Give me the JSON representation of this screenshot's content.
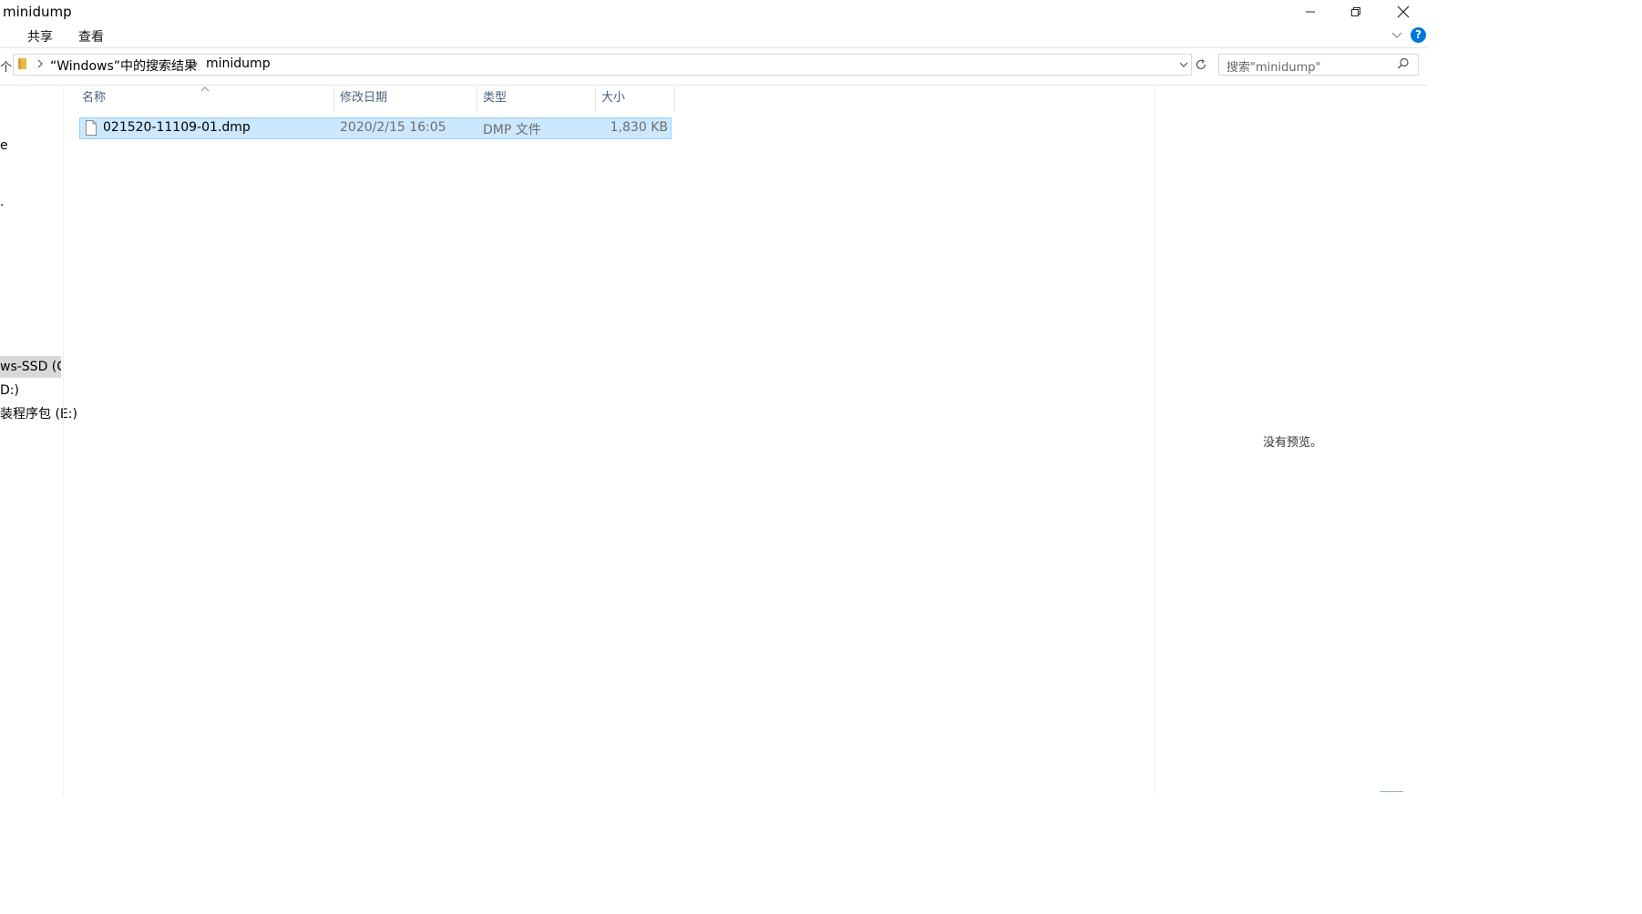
{
  "window": {
    "title": "minidump"
  },
  "ribbon": {
    "tabs": [
      "共享",
      "查看"
    ]
  },
  "address": {
    "crumbs": [
      "“Windows”中的搜索结果",
      "minidump"
    ],
    "search_placeholder": "搜索\"minidump\""
  },
  "nav": {
    "items": [
      {
        "label": "e"
      },
      {
        "label": "."
      },
      {
        "label": "ws-SSD (C:)"
      },
      {
        "label": "D:)"
      },
      {
        "label": "装程序包 (E:)"
      }
    ],
    "up_label": "个"
  },
  "list": {
    "columns": [
      "名称",
      "修改日期",
      "类型",
      "大小"
    ],
    "rows": [
      {
        "name": "021520-11109-01.dmp",
        "modified": "2020/2/15 16:05",
        "type": "DMP 文件",
        "size": "1,830 KB"
      }
    ]
  },
  "preview": {
    "empty_text": "没有预览。"
  },
  "colors": {
    "selection_bg": "#cce8ff",
    "selection_border": "#99d1ff",
    "header_text": "#4c607a",
    "help_blue": "#0078d7"
  },
  "icons": [
    "minimize-icon",
    "restore-icon",
    "close-icon",
    "chevron-down-icon",
    "help-icon",
    "folder-icon",
    "chevron-right-icon",
    "refresh-icon",
    "search-icon",
    "file-icon",
    "sort-up-icon"
  ]
}
